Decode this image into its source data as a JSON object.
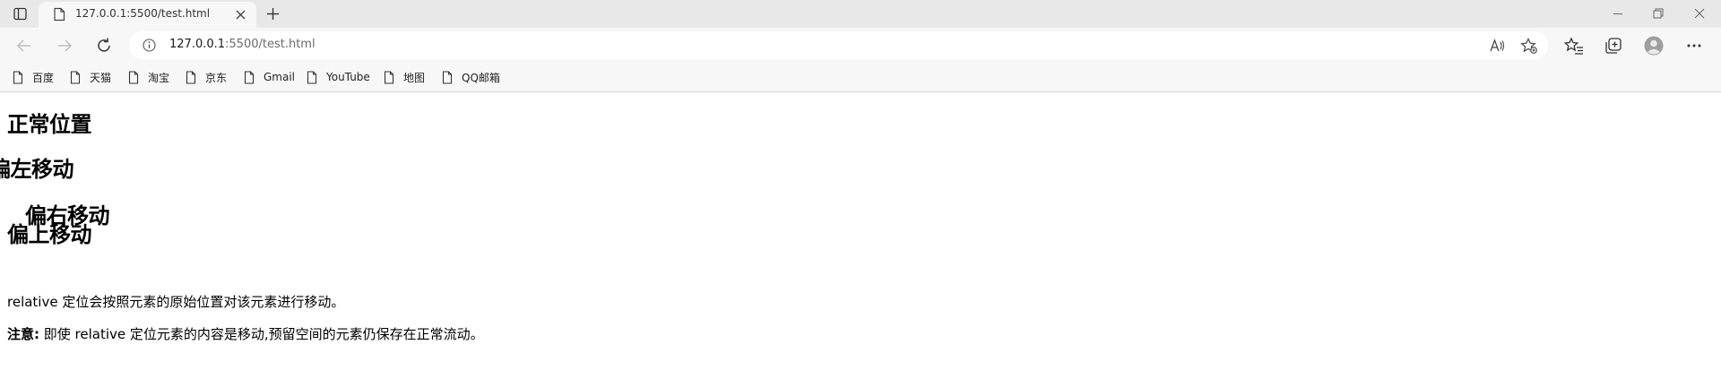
{
  "tab": {
    "title": "127.0.0.1:5500/test.html"
  },
  "address": {
    "host": "127.0.0.1",
    "rest": ":5500/test.html"
  },
  "bookmarks": [
    {
      "label": "百度"
    },
    {
      "label": "天猫"
    },
    {
      "label": "淘宝"
    },
    {
      "label": "京东"
    },
    {
      "label": "Gmail"
    },
    {
      "label": "YouTube"
    },
    {
      "label": "地图"
    },
    {
      "label": "QQ邮箱"
    }
  ],
  "content": {
    "heading_normal": "正常位置",
    "heading_left": "偏左移动",
    "heading_right": "偏右移动",
    "heading_up": "偏上移动",
    "para1": "relative 定位会按照元素的原始位置对该元素进行移动。",
    "para2_bold": "注意:",
    "para2_text": " 即使 relative 定位元素的内容是移动,预留空间的元素仍保存在正常流动。"
  }
}
